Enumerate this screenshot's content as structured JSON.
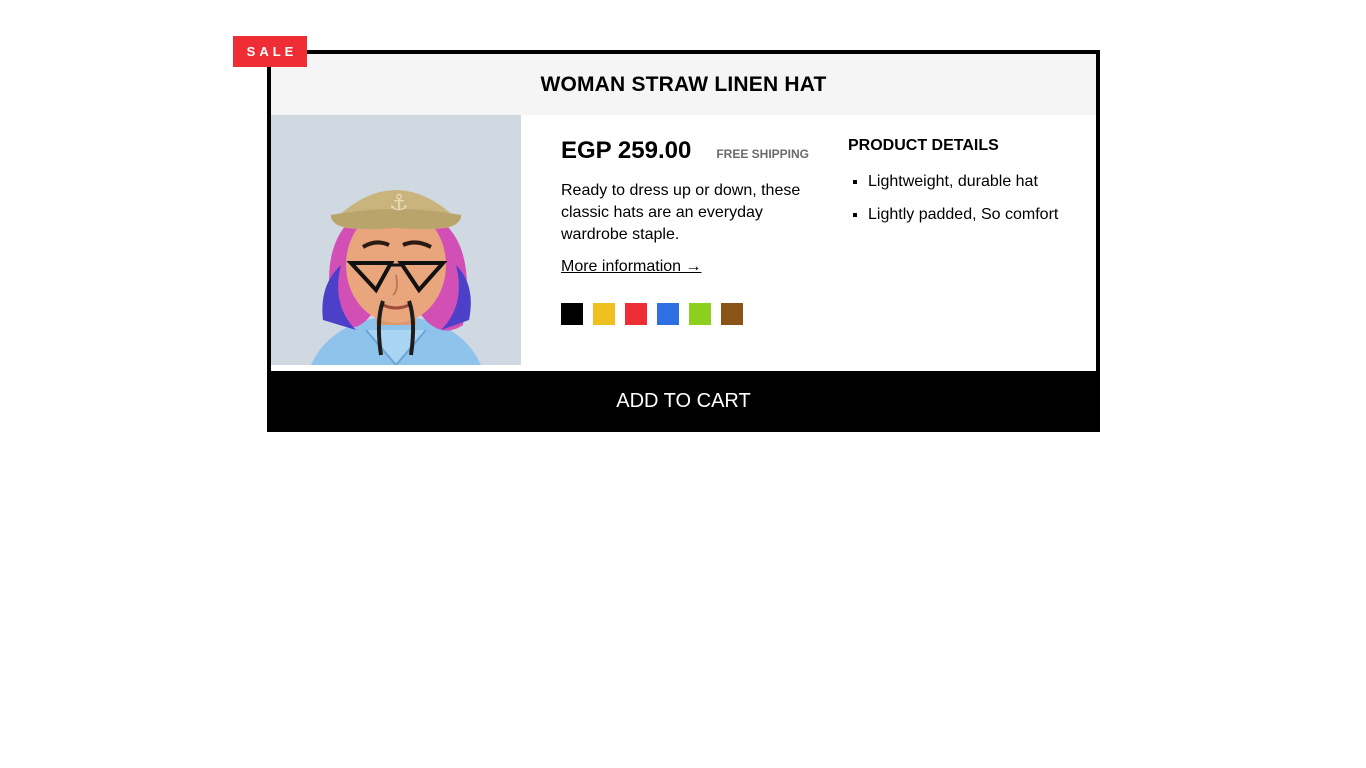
{
  "badge": {
    "label": "SALE",
    "color": "#ee2e34"
  },
  "product": {
    "title": "WOMAN STRAW LINEN HAT",
    "price": "EGP 259.00",
    "shipping": "FREE SHIPPING",
    "description": "Ready to dress up or down, these classic hats are an everyday wardrobe staple.",
    "more_link": "More information →",
    "image_icon": "avatar-portrait-image",
    "colors": [
      "#000000",
      "#f0c020",
      "#ee2e34",
      "#2f6fe4",
      "#8ccf1e",
      "#8a5418"
    ]
  },
  "details": {
    "title": "PRODUCT DETAILS",
    "items": [
      "Lightweight, durable hat",
      "Lightly padded, So comfort"
    ]
  },
  "cart": {
    "label": "ADD TO CART"
  }
}
